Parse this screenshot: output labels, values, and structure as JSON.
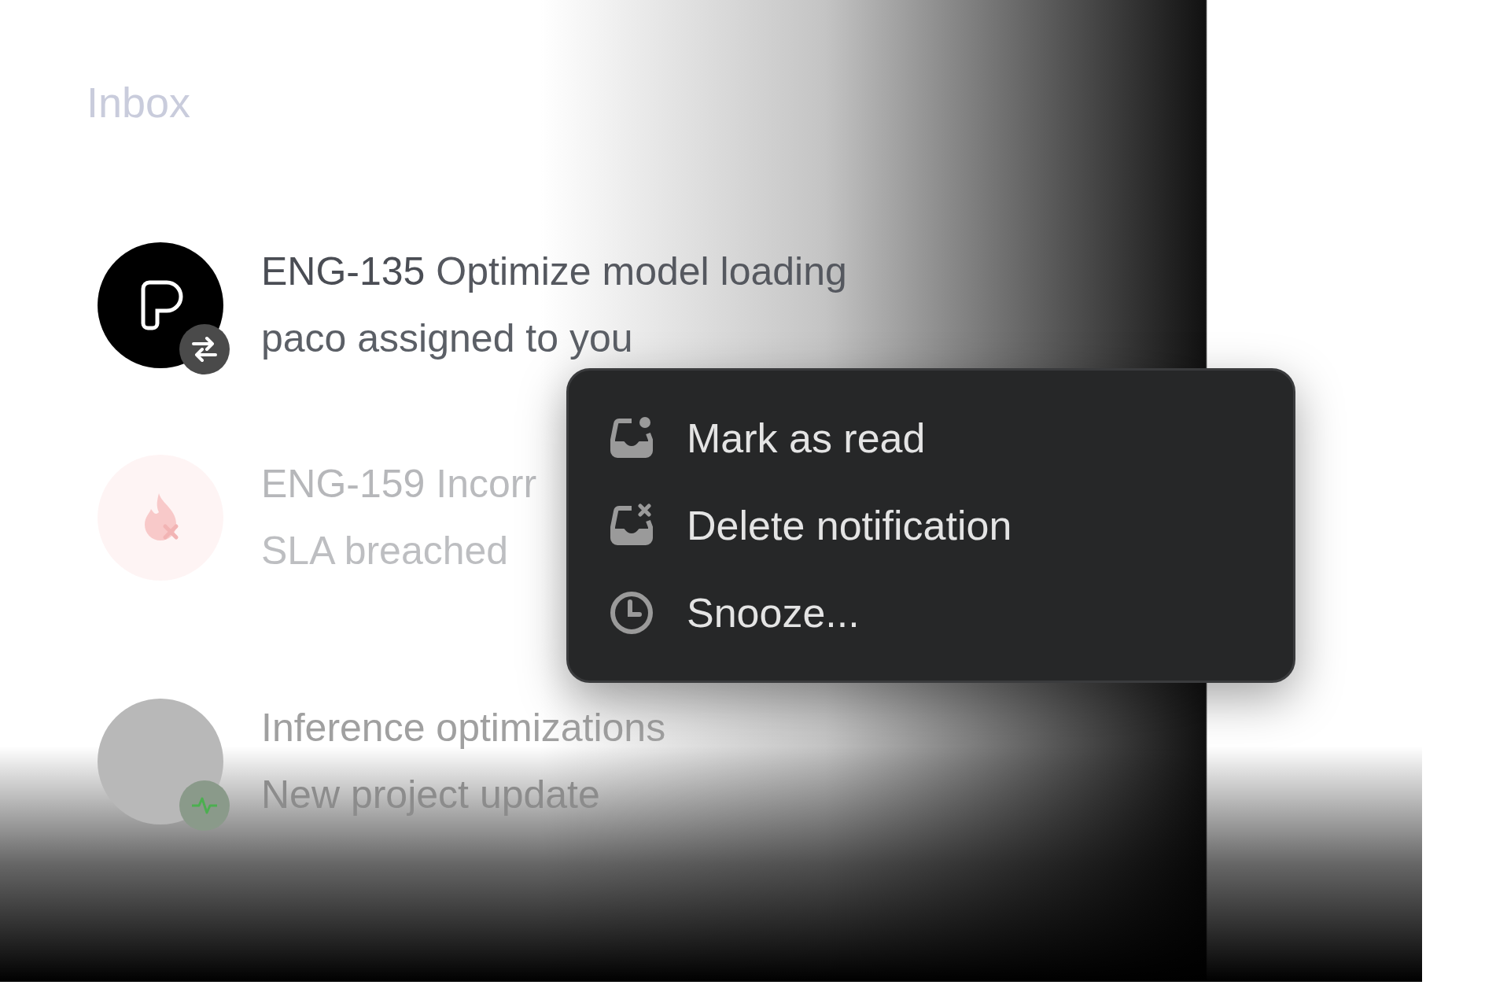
{
  "header": {
    "title": "Inbox"
  },
  "notifications": [
    {
      "id": "ENG-135",
      "title": "Optimize model loading",
      "subtitle": "paco assigned to you"
    },
    {
      "id": "ENG-159",
      "title": "Incorr",
      "subtitle": "SLA breached"
    },
    {
      "title": "Inference optimizations",
      "subtitle": "New project update"
    }
  ],
  "context_menu": {
    "items": [
      {
        "label": "Mark as read"
      },
      {
        "label": "Delete notification"
      },
      {
        "label": "Snooze..."
      }
    ]
  }
}
